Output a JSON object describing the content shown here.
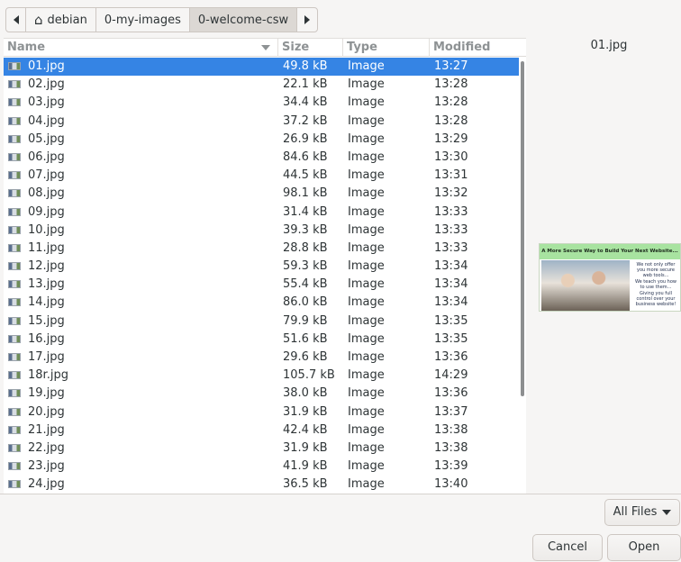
{
  "pathbar": {
    "segments": [
      "debian",
      "0-my-images",
      "0-welcome-csw"
    ]
  },
  "columns": {
    "name": "Name",
    "size": "Size",
    "type": "Type",
    "modified": "Modified"
  },
  "files": [
    {
      "name": "01.jpg",
      "size": "49.8 kB",
      "type": "Image",
      "modified": "13:27"
    },
    {
      "name": "02.jpg",
      "size": "22.1 kB",
      "type": "Image",
      "modified": "13:28"
    },
    {
      "name": "03.jpg",
      "size": "34.4 kB",
      "type": "Image",
      "modified": "13:28"
    },
    {
      "name": "04.jpg",
      "size": "37.2 kB",
      "type": "Image",
      "modified": "13:28"
    },
    {
      "name": "05.jpg",
      "size": "26.9 kB",
      "type": "Image",
      "modified": "13:29"
    },
    {
      "name": "06.jpg",
      "size": "84.6 kB",
      "type": "Image",
      "modified": "13:30"
    },
    {
      "name": "07.jpg",
      "size": "44.5 kB",
      "type": "Image",
      "modified": "13:31"
    },
    {
      "name": "08.jpg",
      "size": "98.1 kB",
      "type": "Image",
      "modified": "13:32"
    },
    {
      "name": "09.jpg",
      "size": "31.4 kB",
      "type": "Image",
      "modified": "13:33"
    },
    {
      "name": "10.jpg",
      "size": "39.3 kB",
      "type": "Image",
      "modified": "13:33"
    },
    {
      "name": "11.jpg",
      "size": "28.8 kB",
      "type": "Image",
      "modified": "13:33"
    },
    {
      "name": "12.jpg",
      "size": "59.3 kB",
      "type": "Image",
      "modified": "13:34"
    },
    {
      "name": "13.jpg",
      "size": "55.4 kB",
      "type": "Image",
      "modified": "13:34"
    },
    {
      "name": "14.jpg",
      "size": "86.0 kB",
      "type": "Image",
      "modified": "13:34"
    },
    {
      "name": "15.jpg",
      "size": "79.9 kB",
      "type": "Image",
      "modified": "13:35"
    },
    {
      "name": "16.jpg",
      "size": "51.6 kB",
      "type": "Image",
      "modified": "13:35"
    },
    {
      "name": "17.jpg",
      "size": "29.6 kB",
      "type": "Image",
      "modified": "13:36"
    },
    {
      "name": "18r.jpg",
      "size": "105.7 kB",
      "type": "Image",
      "modified": "14:29"
    },
    {
      "name": "19.jpg",
      "size": "38.0 kB",
      "type": "Image",
      "modified": "13:36"
    },
    {
      "name": "20.jpg",
      "size": "31.9 kB",
      "type": "Image",
      "modified": "13:37"
    },
    {
      "name": "21.jpg",
      "size": "42.4 kB",
      "type": "Image",
      "modified": "13:38"
    },
    {
      "name": "22.jpg",
      "size": "31.9 kB",
      "type": "Image",
      "modified": "13:38"
    },
    {
      "name": "23.jpg",
      "size": "41.9 kB",
      "type": "Image",
      "modified": "13:39"
    },
    {
      "name": "24.jpg",
      "size": "36.5 kB",
      "type": "Image",
      "modified": "13:40"
    }
  ],
  "selected_index": 0,
  "preview": {
    "filename": "01.jpg",
    "image_heading": "A More Secure Way to Build Your Next Website...",
    "image_text_1": "We not only offer you more secure web tools...",
    "image_text_2": "We teach you how to use them...",
    "image_text_3": "Giving you full control over your business website!"
  },
  "filter": {
    "label": "All Files"
  },
  "buttons": {
    "cancel": "Cancel",
    "open": "Open"
  },
  "colors": {
    "selection": "#3584e4",
    "background": "#f6f5f4"
  }
}
